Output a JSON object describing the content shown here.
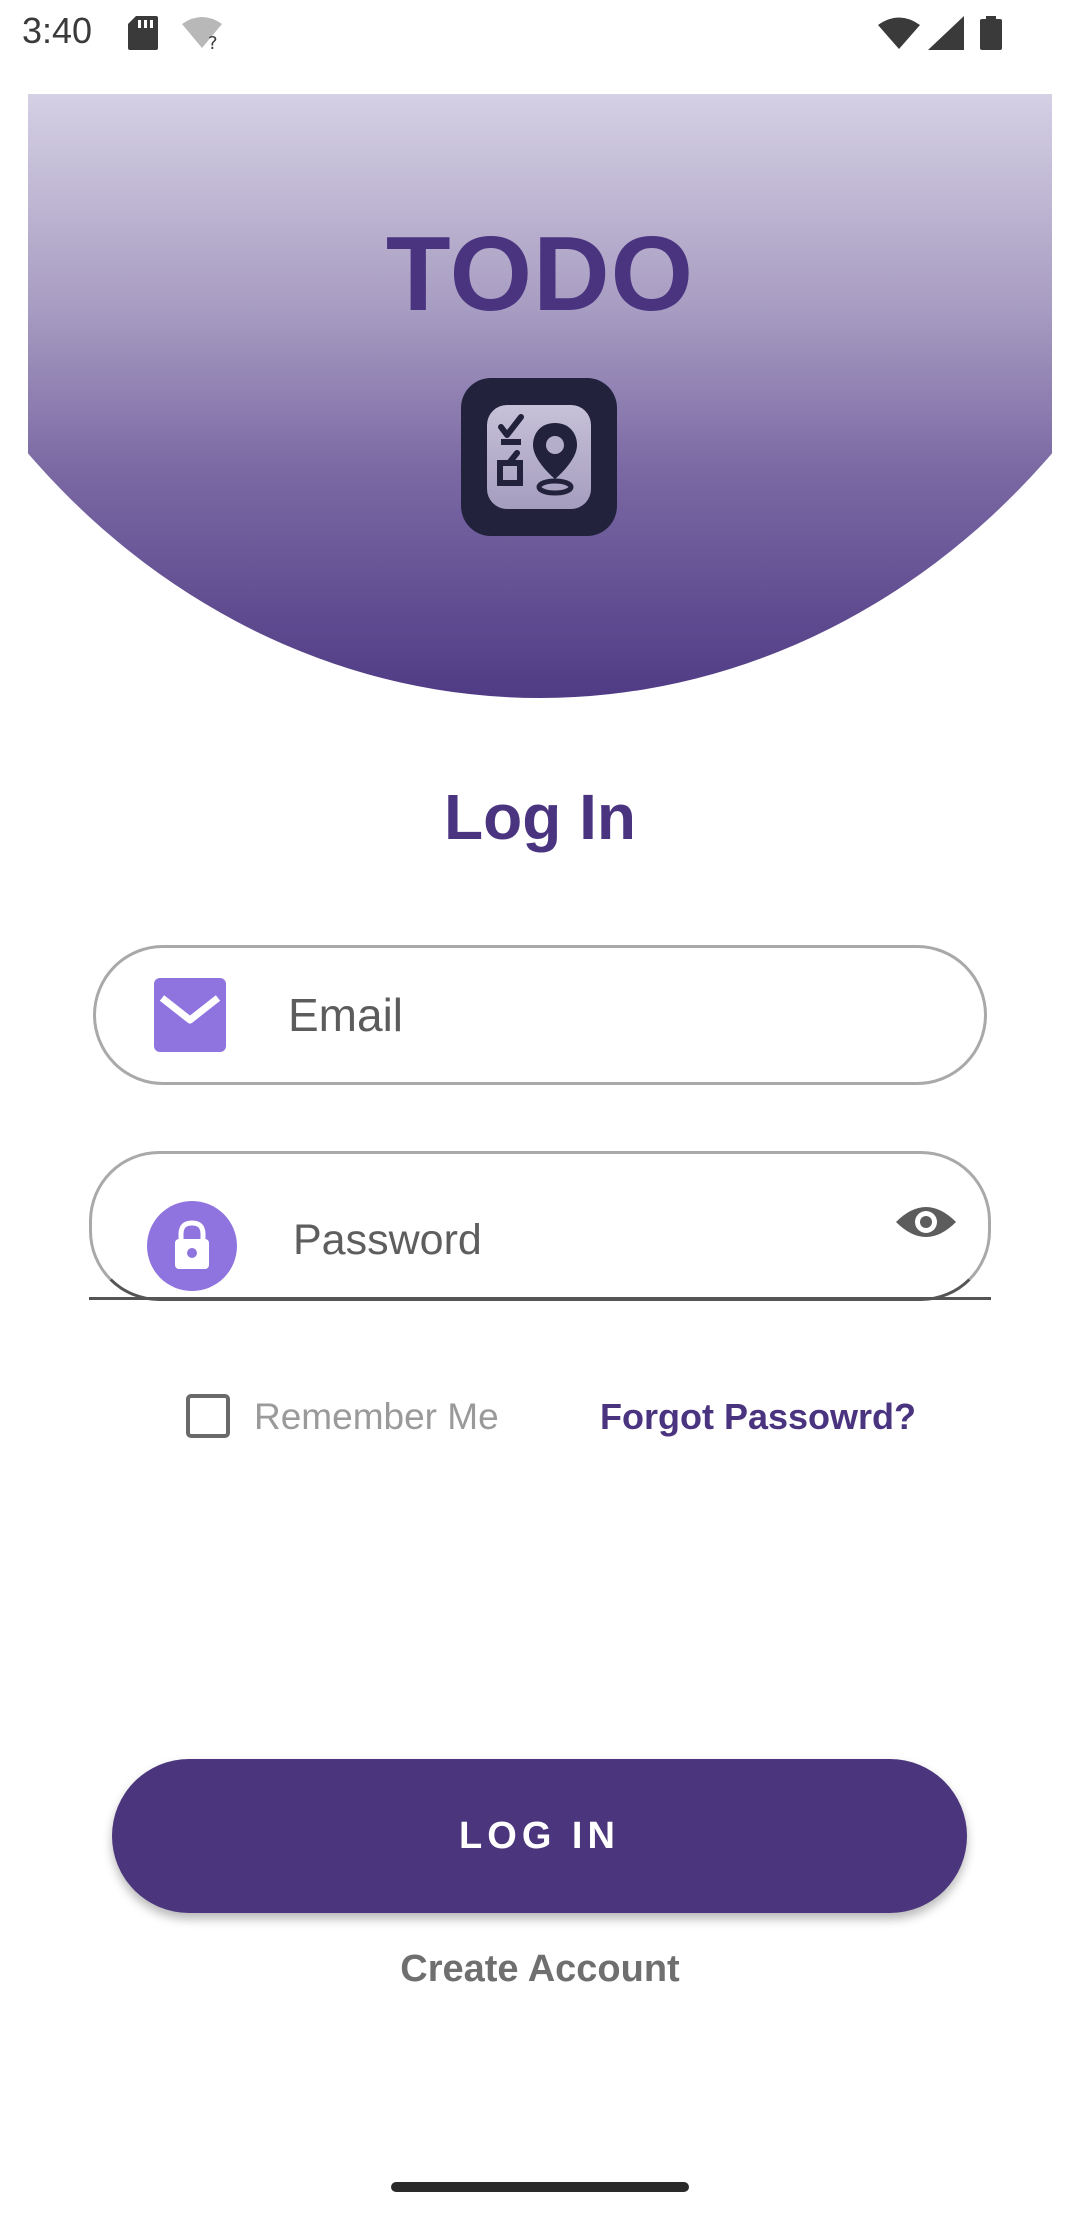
{
  "status_bar": {
    "time": "3:40",
    "icons": [
      "sd-card-icon",
      "wifi-question-icon",
      "wifi-icon",
      "signal-icon",
      "battery-icon"
    ]
  },
  "header": {
    "app_title": "TODO",
    "logo_icon": "todo-checklist-location-logo",
    "gradient_colors": [
      "#d5d0e4",
      "#a89dc2",
      "#7b69a4",
      "#4f3b84"
    ]
  },
  "login": {
    "title": "Log In",
    "email": {
      "placeholder": "Email",
      "icon": "mail-icon"
    },
    "password": {
      "placeholder": "Password",
      "icon": "lock-icon",
      "toggle_icon": "eye-icon"
    },
    "remember_me": {
      "label": "Remember Me",
      "checked": false
    },
    "forgot_password": "Forgot Passowrd?",
    "login_button": "LOG IN",
    "create_account": "Create Account"
  },
  "colors": {
    "primary": "#4b357d",
    "accent": "#8f74e0",
    "text_muted": "#9a9a9a"
  }
}
